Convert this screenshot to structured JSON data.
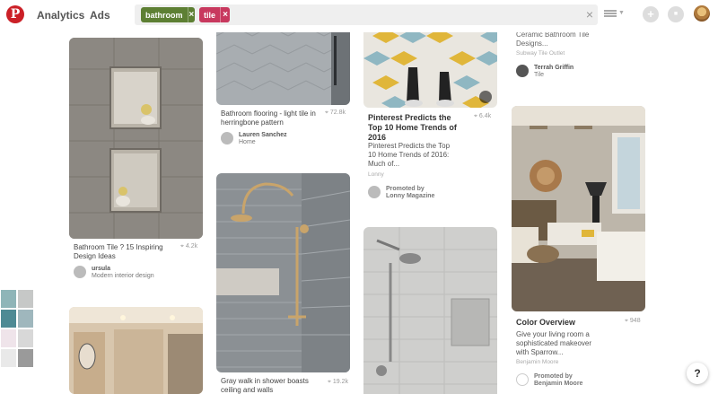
{
  "header": {
    "logo": "P",
    "nav": [
      "Analytics",
      "Ads"
    ],
    "search_chips": [
      {
        "label": "bathroom",
        "color": "#5d7f33"
      },
      {
        "label": "tile",
        "color": "#c8385e"
      }
    ],
    "clear_icon": "×",
    "chip_remove": "×",
    "plus_icon": "+",
    "chat_icon": "■"
  },
  "pins": [
    {
      "title": "Bathroom Tile ? 15 Inspiring Design Ideas",
      "count": "4.2k",
      "user": "ursula",
      "board": "Modern interior design"
    },
    {
      "title": "Bathroom flooring - light tile in herringbone pattern",
      "count": "72.8k",
      "user": "Lauren Sanchez",
      "board": "Home"
    },
    {
      "title": "Gray walk in shower boasts ceiling and walls",
      "count": "19.2k"
    },
    {
      "title": "Pinterest Predicts the Top 10 Home Trends of 2016",
      "count": "6.4k",
      "description": "Pinterest Predicts the Top 10 Home Trends of 2016: Much of...",
      "source": "Lonny",
      "promoted_label": "Promoted by",
      "promoter": "Lonny Magazine"
    },
    {
      "title_partial": "Ceramic Bathroom Tile Designs...",
      "source": "Subway Tile Outlet",
      "user": "Terrah Griffin",
      "board": "Tile"
    },
    {
      "title": "Color Overview",
      "count": "948",
      "description": "Give your living room a sophisticated makeover with Sparrow...",
      "source": "Benjamin Moore",
      "promoted_label": "Promoted by",
      "promoter": "Benjamin Moore"
    }
  ],
  "help_label": "?",
  "pin_icon_glyph": "⌖",
  "colors": {
    "pinterest_red": "#cb2027",
    "chip_bathroom": "#5d7f33",
    "chip_tile": "#c8385e"
  }
}
